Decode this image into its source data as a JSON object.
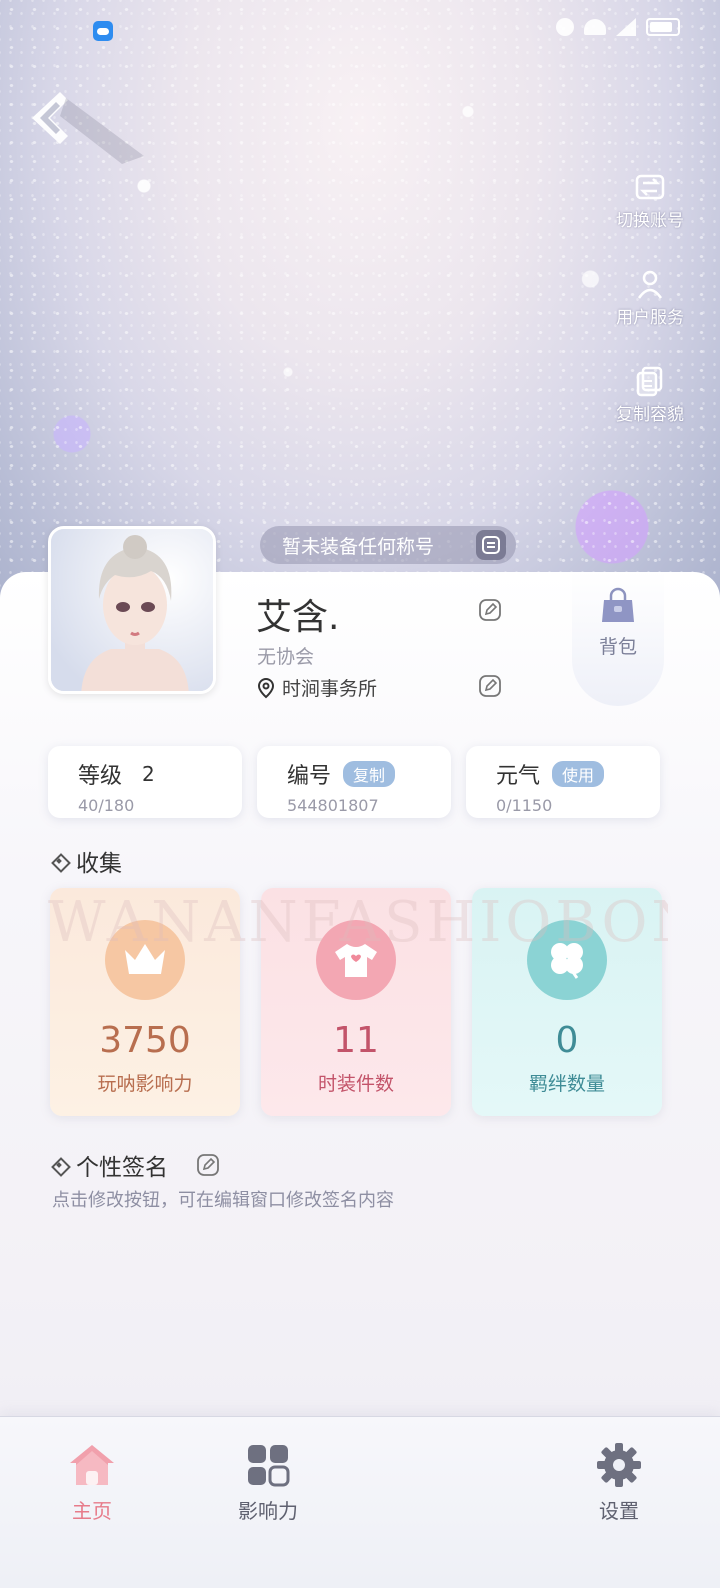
{
  "status_bar": {
    "time": ""
  },
  "side_actions": [
    {
      "label": "切换账号",
      "icon": "switch-account-icon"
    },
    {
      "label": "用户服务",
      "icon": "user-service-icon"
    },
    {
      "label": "复制容貌",
      "icon": "copy-appearance-icon"
    }
  ],
  "title_chip": {
    "text": "暂未装备任何称号"
  },
  "profile": {
    "nickname": "艾含.",
    "guild": "无协会",
    "location": "时涧事务所"
  },
  "bag": {
    "label": "背包"
  },
  "stats": {
    "level": {
      "name": "等级",
      "value": "2",
      "sub": "40/180"
    },
    "id": {
      "name": "编号",
      "action": "复制",
      "sub": "544801807"
    },
    "energy": {
      "name": "元气",
      "action": "使用",
      "sub": "0/1150"
    }
  },
  "collection": {
    "title": "收集",
    "watermark": "WANANFASHIOBOND",
    "cards": [
      {
        "value": "3750",
        "label": "玩呐影响力",
        "icon": "crown-icon"
      },
      {
        "value": "11",
        "label": "时装件数",
        "icon": "shirt-icon"
      },
      {
        "value": "0",
        "label": "羁绊数量",
        "icon": "clover-icon"
      }
    ]
  },
  "signature": {
    "title": "个性签名",
    "text": "点击修改按钮，可在编辑窗口修改签名内容"
  },
  "nav": {
    "home": "主页",
    "influence": "影响力",
    "settings": "设置"
  },
  "colors": {
    "nav_active": "#e77b8a",
    "pill": "#9fbde0",
    "orange": "#b86e4f",
    "pink": "#c3546a",
    "teal": "#3f8c96"
  }
}
